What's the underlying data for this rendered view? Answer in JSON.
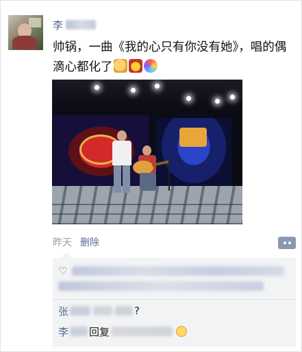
{
  "post": {
    "username": "李",
    "text": "帅锅，一曲《我的心只有你没有她》，唱的偶滴心都化了",
    "emojis": [
      "thumbs-up",
      "crown",
      "party-popper"
    ]
  },
  "meta": {
    "time": "昨天",
    "delete_label": "删除"
  },
  "comments": {
    "rows": [
      {
        "name": "张",
        "text": "?"
      },
      {
        "name": "李",
        "text": "回复"
      }
    ]
  },
  "colors": {
    "link": "#576b95",
    "comment_bg": "#f2f3f5",
    "action_btn": "#8a99b1"
  }
}
